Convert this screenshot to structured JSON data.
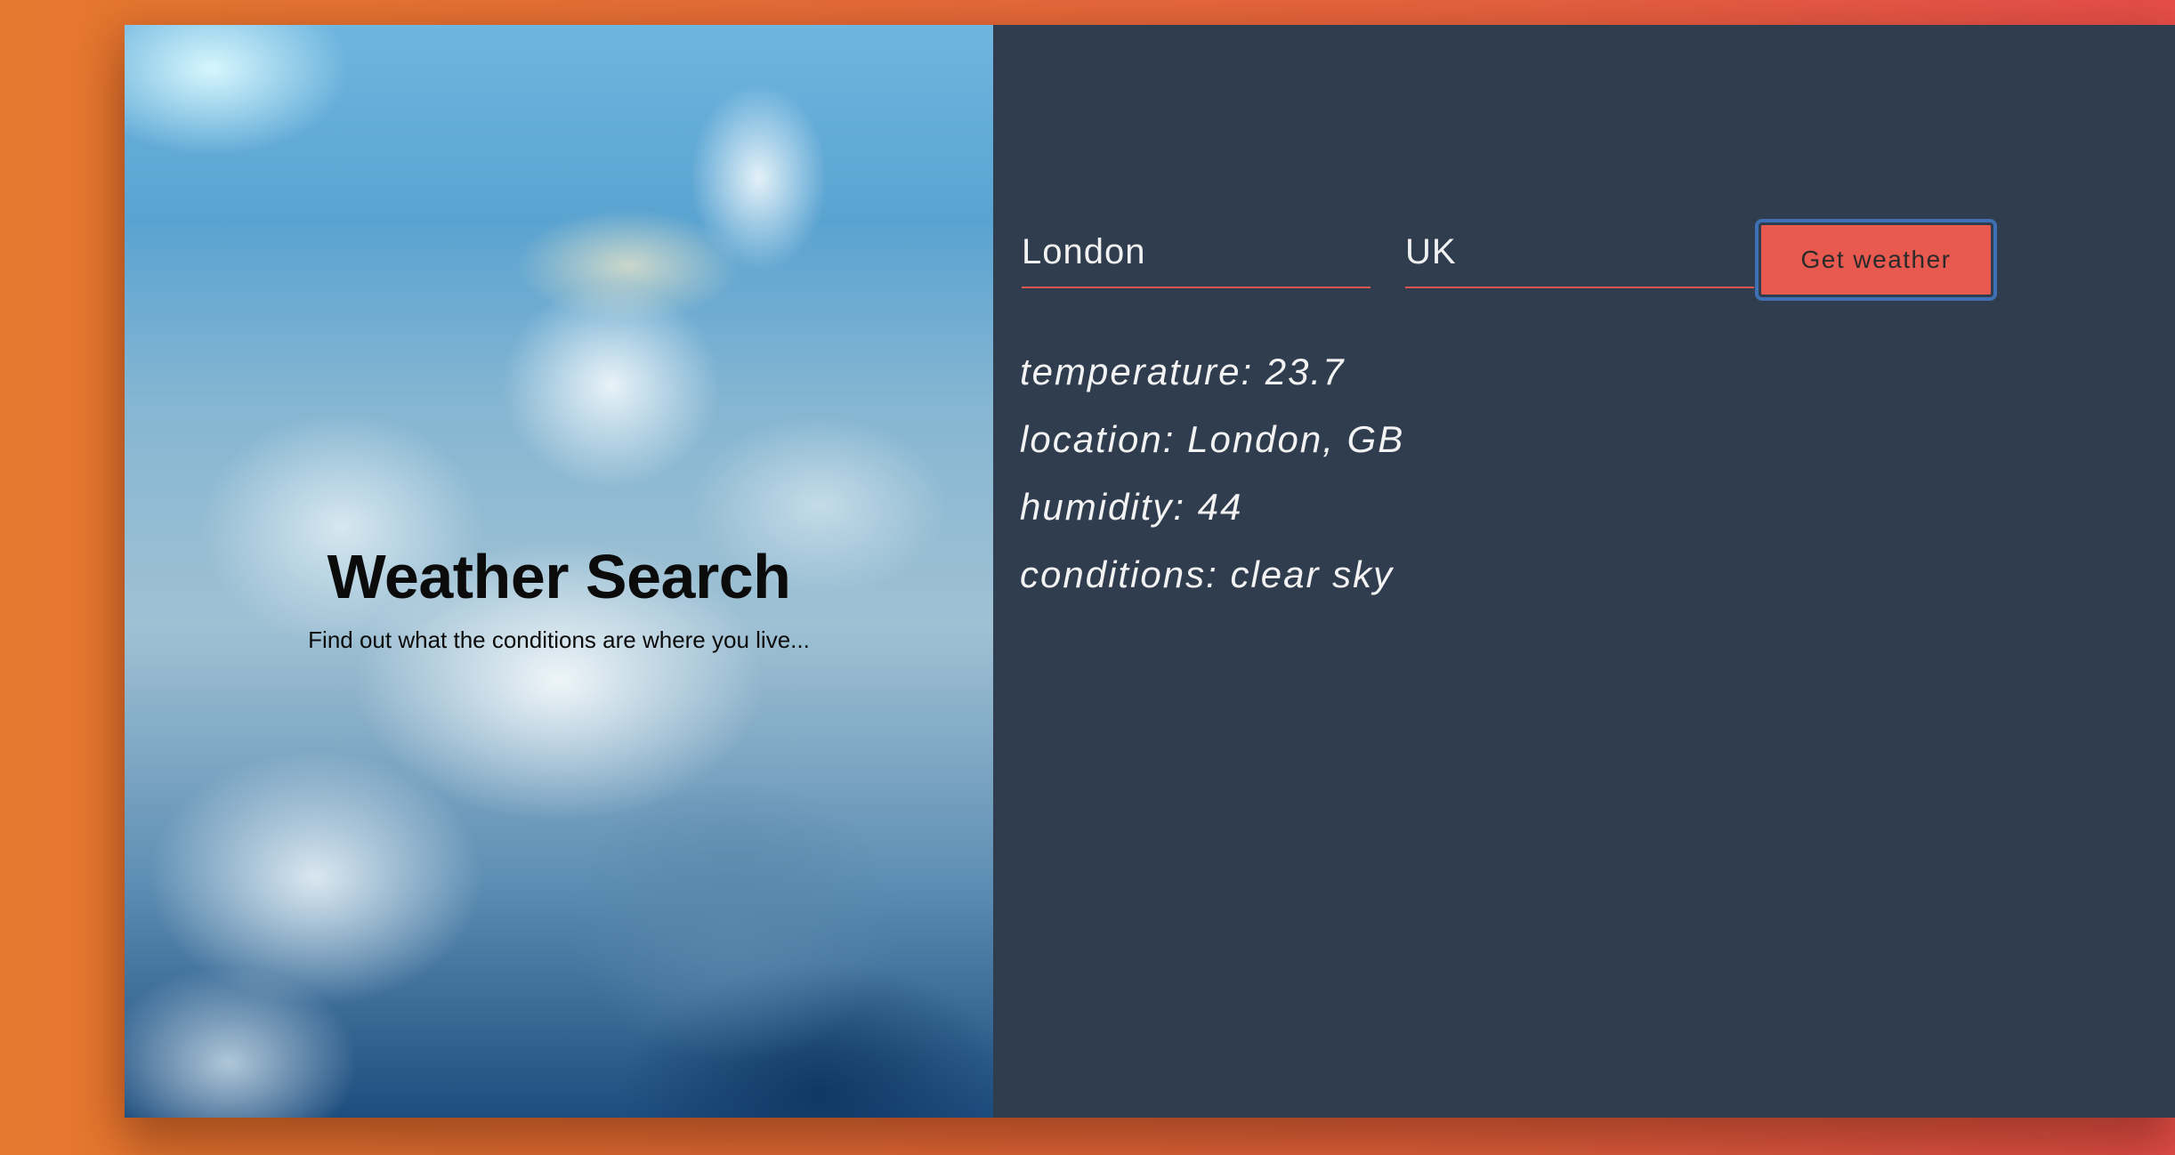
{
  "hero": {
    "title": "Weather Search",
    "subtitle": "Find out what the conditions are where you live..."
  },
  "form": {
    "city_value": "London",
    "country_value": "UK",
    "submit_label": "Get weather"
  },
  "results": {
    "temperature": "temperature: 23.7",
    "location": "location: London, GB",
    "humidity": "humidity: 44",
    "conditions": "conditions: clear sky"
  },
  "colors": {
    "background_start": "#e5782f",
    "background_end": "#e54d4a",
    "panel": "#2f3d4e",
    "accent": "#e85a4f",
    "focus_ring": "#3f6fb5"
  }
}
